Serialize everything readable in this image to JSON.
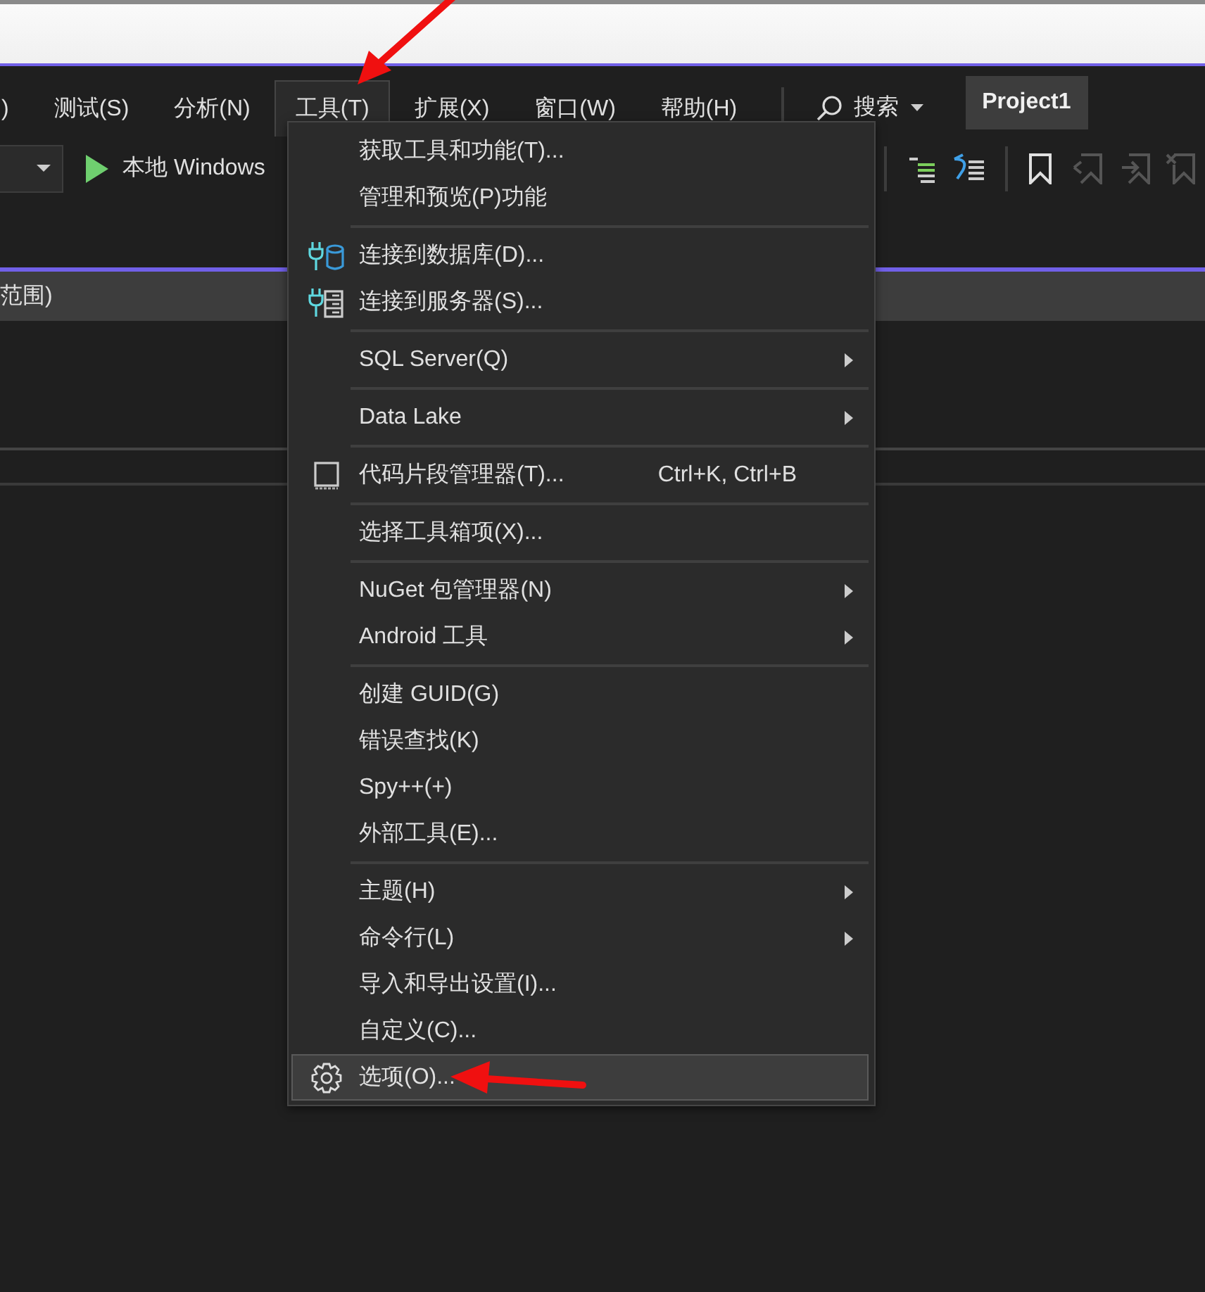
{
  "menu_bar": [
    {
      "label": ")",
      "selected": false
    },
    {
      "label": "测试(S)",
      "selected": false
    },
    {
      "label": "分析(N)",
      "selected": false
    },
    {
      "label": "工具(T)",
      "selected": true
    },
    {
      "label": "扩展(X)",
      "selected": false
    },
    {
      "label": "窗口(W)",
      "selected": false
    },
    {
      "label": "帮助(H)",
      "selected": false
    }
  ],
  "search": {
    "label": "搜索"
  },
  "project": {
    "label": "Project1"
  },
  "toolbar": {
    "run_label": "本地 Windows"
  },
  "panel_tab": {
    "label": "范围)"
  },
  "dropdown": {
    "groups": [
      {
        "items": [
          {
            "label": "获取工具和功能(T)...",
            "submenu": false,
            "selected": false
          },
          {
            "label": "管理和预览(P)功能",
            "submenu": false,
            "selected": false
          }
        ]
      },
      {
        "items": [
          {
            "label": "连接到数据库(D)...",
            "kind": "database",
            "submenu": false,
            "selected": false
          },
          {
            "label": "连接到服务器(S)...",
            "kind": "server",
            "submenu": false,
            "selected": false
          }
        ]
      },
      {
        "items": [
          {
            "label": "SQL Server(Q)",
            "submenu": true,
            "selected": false
          }
        ]
      },
      {
        "items": [
          {
            "label": "Data Lake",
            "submenu": true,
            "selected": false
          }
        ]
      },
      {
        "items": [
          {
            "label": "代码片段管理器(T)...",
            "kind": "snippet",
            "shortcut": "Ctrl+K, Ctrl+B",
            "submenu": false,
            "selected": false
          }
        ]
      },
      {
        "items": [
          {
            "label": "选择工具箱项(X)...",
            "submenu": false,
            "selected": false
          }
        ]
      },
      {
        "items": [
          {
            "label": "NuGet 包管理器(N)",
            "submenu": true,
            "selected": false
          },
          {
            "label": "Android 工具",
            "submenu": true,
            "selected": false
          }
        ]
      },
      {
        "items": [
          {
            "label": "创建 GUID(G)",
            "submenu": false,
            "selected": false
          },
          {
            "label": "错误查找(K)",
            "submenu": false,
            "selected": false
          },
          {
            "label": "Spy++(+)",
            "submenu": false,
            "selected": false
          },
          {
            "label": "外部工具(E)...",
            "submenu": false,
            "selected": false
          }
        ]
      },
      {
        "items": [
          {
            "label": "主题(H)",
            "submenu": true,
            "selected": false
          },
          {
            "label": "命令行(L)",
            "submenu": true,
            "selected": false
          },
          {
            "label": "导入和导出设置(I)...",
            "submenu": false,
            "selected": false
          },
          {
            "label": "自定义(C)...",
            "submenu": false,
            "selected": false
          },
          {
            "label": "选项(O)...",
            "kind": "gear",
            "submenu": false,
            "selected": true
          }
        ]
      }
    ]
  }
}
